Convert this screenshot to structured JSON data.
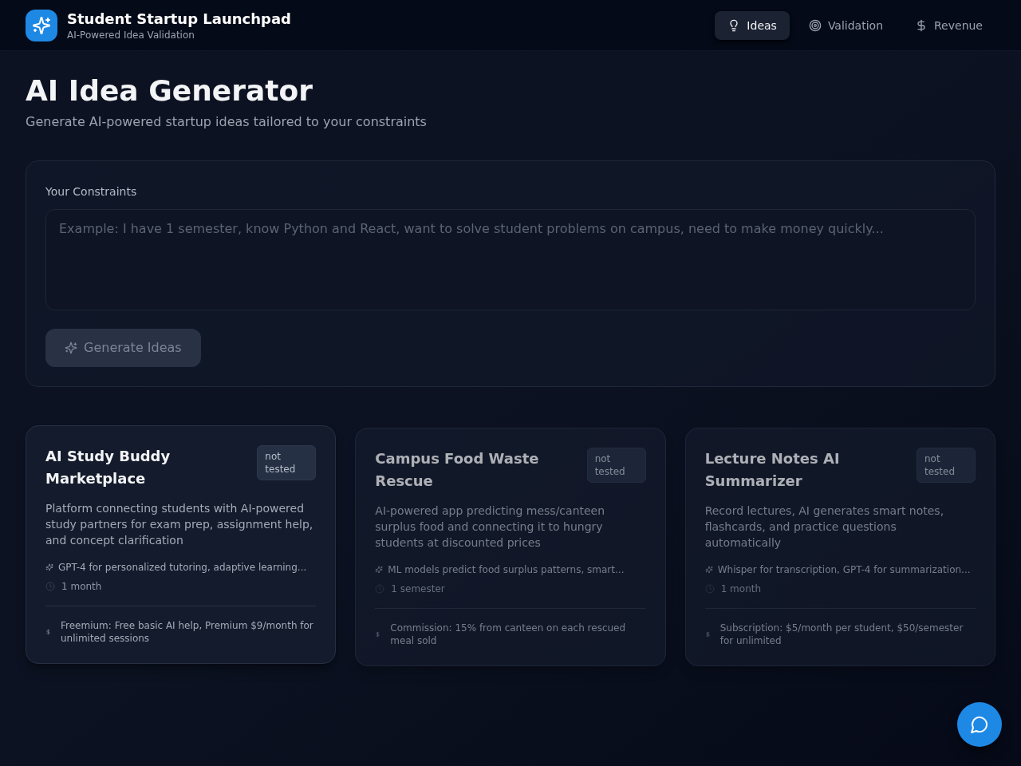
{
  "header": {
    "title": "Student Startup Launchpad",
    "subtitle": "AI-Powered Idea Validation"
  },
  "nav": [
    {
      "label": "Ideas",
      "selected": true
    },
    {
      "label": "Validation",
      "selected": false
    },
    {
      "label": "Revenue",
      "selected": false
    }
  ],
  "page": {
    "title": "AI Idea Generator",
    "subtitle": "Generate AI-powered startup ideas tailored to your constraints"
  },
  "constraints": {
    "label": "Your Constraints",
    "placeholder": "Example: I have 1 semester, know Python and React, want to solve student problems on campus, need to make money quickly...",
    "button": {
      "label": "Generate Ideas",
      "disabled": true
    }
  },
  "ideas": [
    {
      "dimmed": false,
      "title": "AI Study Buddy Marketplace",
      "status": "not tested",
      "description": "Platform connecting students with AI-powered study partners for exam prep, assignment help, and concept clarification",
      "tech": "GPT-4 for personalized tutoring, adaptive learning...",
      "time": "1 month",
      "revenue": "Freemium: Free basic AI help, Premium $9/month for unlimited sessions"
    },
    {
      "dimmed": true,
      "title": "Campus Food Waste Rescue",
      "status": "not tested",
      "description": "AI-powered app predicting mess/canteen surplus food and connecting it to hungry students at discounted prices",
      "tech": "ML models predict food surplus patterns, smart...",
      "time": "1 semester",
      "revenue": "Commission: 15% from canteen on each rescued meal sold"
    },
    {
      "dimmed": true,
      "title": "Lecture Notes AI Summarizer",
      "status": "not tested",
      "description": "Record lectures, AI generates smart notes, flashcards, and practice questions automatically",
      "tech": "Whisper for transcription, GPT-4 for summarization...",
      "time": "1 month",
      "revenue": "Subscription: $5/month per student, $50/semester for unlimited"
    }
  ]
}
